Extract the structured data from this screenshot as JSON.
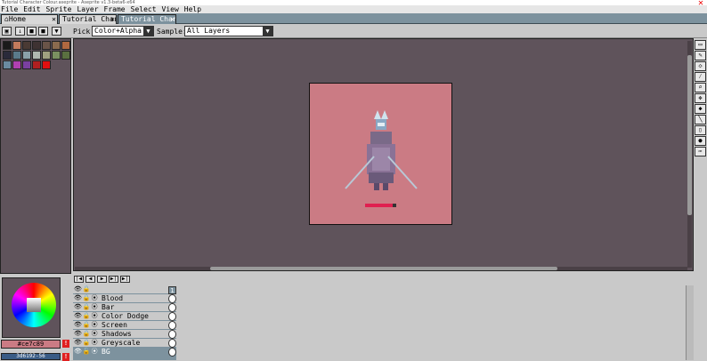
{
  "window": {
    "title": "Tutorial Character Colour.aseprite - Aseprite v1.3-beta6-x64",
    "close_icon": "close-icon"
  },
  "menu": [
    "File",
    "Edit",
    "Sprite",
    "Layer",
    "Frame",
    "Select",
    "View",
    "Help"
  ],
  "tabs": [
    {
      "label": "Home",
      "icon": "home-icon",
      "active": false
    },
    {
      "label": "Tutorial Charac",
      "active": false
    },
    {
      "label": "Tutorial Charac",
      "active": true
    }
  ],
  "toolbar": {
    "pick_label": "Pick:",
    "pick_value": "Color+Alpha",
    "sample_label": "Sample:",
    "sample_value": "All Layers"
  },
  "palette": {
    "colors": [
      "#1a1a1a",
      "#c27a5c",
      "#4a3a34",
      "#3e3232",
      "#6a5448",
      "#8a6a4e",
      "#b06840",
      "#2a2a3a",
      "#5a7a8a",
      "#8aa0a8",
      "#b0b8b0",
      "#a0a080",
      "#7a9060",
      "#5a7040",
      "#6a8aa0",
      "#b040b0",
      "#7a40a0",
      "#b02020",
      "#e01010"
    ]
  },
  "color": {
    "fg_hex": "#ce7c89",
    "bg_hex": "3d6192-56"
  },
  "timeline": {
    "frame_label": "1",
    "layers": [
      {
        "name": "",
        "group": true
      },
      {
        "name": "Blood"
      },
      {
        "name": "Bar"
      },
      {
        "name": "Color Dodge"
      },
      {
        "name": "Screen"
      },
      {
        "name": "Shadows"
      },
      {
        "name": "Greyscale"
      },
      {
        "name": "BG",
        "active": true
      }
    ]
  }
}
